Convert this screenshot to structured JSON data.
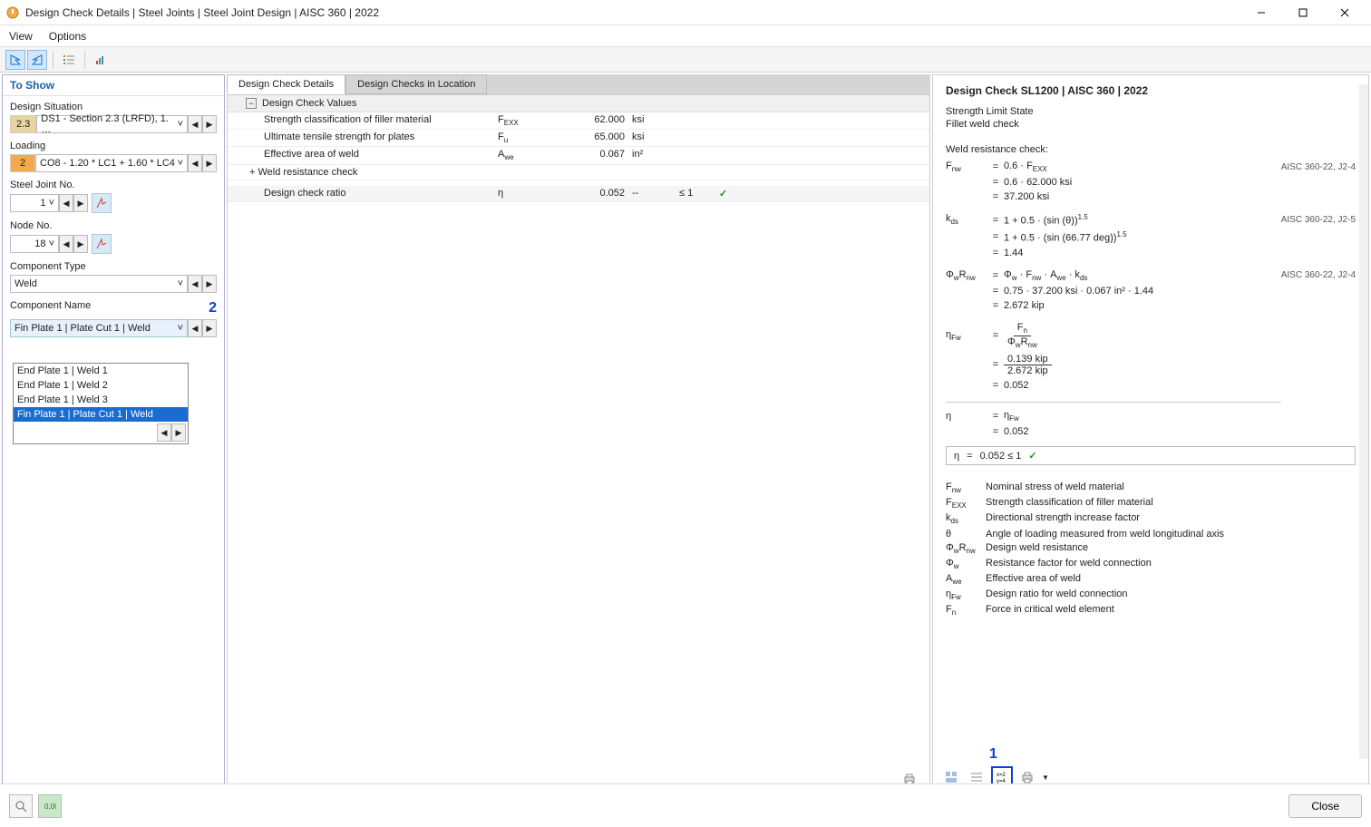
{
  "window": {
    "title": "Design Check Details | Steel Joints | Steel Joint Design | AISC 360 | 2022"
  },
  "menu": {
    "view": "View",
    "options": "Options"
  },
  "sidebar": {
    "header": "To Show",
    "design_situation_label": "Design Situation",
    "design_situation_badge": "2.3",
    "design_situation_value": "DS1 - Section 2.3 (LRFD), 1. …",
    "loading_label": "Loading",
    "loading_badge": "2",
    "loading_value": "CO8 - 1.20 * LC1 + 1.60 * LC4",
    "steel_joint_label": "Steel Joint No.",
    "steel_joint_value": "1",
    "node_label": "Node No.",
    "node_value": "18",
    "component_type_label": "Component Type",
    "component_type_value": "Weld",
    "component_name_label": "Component Name",
    "component_name_value": "Fin Plate 1 | Plate Cut 1 | Weld",
    "component_name_options": [
      "End Plate 1 | Weld 1",
      "End Plate 1 | Weld 2",
      "End Plate 1 | Weld 3",
      "Fin Plate 1 | Plate Cut 1 | Weld"
    ],
    "annotation2": "2"
  },
  "tabs": {
    "tab1": "Design Check Details",
    "tab2": "Design Checks in Location"
  },
  "grid": {
    "section_hdr": "Design Check Values",
    "rows": [
      {
        "name": "Strength classification of filler material",
        "sym": "F_EXX",
        "val": "62.000",
        "unit": "ksi"
      },
      {
        "name": "Ultimate tensile strength for plates",
        "sym": "F_u",
        "val": "65.000",
        "unit": "ksi"
      },
      {
        "name": "Effective area of weld",
        "sym": "A_we",
        "val": "0.067",
        "unit": "in²"
      }
    ],
    "sub_hdr": "Weld resistance check",
    "ratio_row": {
      "name": "Design check ratio",
      "sym": "η",
      "val": "0.052",
      "unit": "--",
      "lim": "≤ 1"
    }
  },
  "right": {
    "title": "Design Check SL1200 | AISC 360 | 2022",
    "sub1": "Strength Limit State",
    "sub2": "Fillet weld check",
    "sec_hdr": "Weld resistance check:",
    "eq1_ref": "AISC 360-22, J2-4",
    "eq1_l1": "0.6  ·  F_EXX",
    "eq1_l2": "0.6  ·  62.000 ksi",
    "eq1_l3": "37.200 ksi",
    "eq2_ref": "AISC 360-22, J2-5",
    "eq2_l1": "1  +  0.5  ·  (sin (θ))^1.5",
    "eq2_l2": "1  +  0.5  ·  (sin (66.77 deg))^1.5",
    "eq2_l3": "1.44",
    "eq3_ref": "AISC 360-22, J2-4",
    "eq3_l1": "Φ_w  ·  F_nw  ·  A_we  ·  k_ds",
    "eq3_l2": "0.75  ·  37.200 ksi  ·  0.067 in²  ·  1.44",
    "eq3_l3": "2.672 kip",
    "eq4_num": "F_n",
    "eq4_den": "Φ_w R_nw",
    "eq4_num2": "0.139 kip",
    "eq4_den2": "2.672 kip",
    "eq4_l3": "0.052",
    "eq5_l1": "η_Fw",
    "eq5_l2": "0.052",
    "result_eta": "η",
    "result_eq": "=",
    "result_val": "0.052  ≤ 1",
    "legend": [
      {
        "sym": "F_nw",
        "desc": "Nominal stress of weld material"
      },
      {
        "sym": "F_EXX",
        "desc": "Strength classification of filler material"
      },
      {
        "sym": "k_ds",
        "desc": "Directional strength increase factor"
      },
      {
        "sym": "θ",
        "desc": "Angle of loading measured from weld longitudinal axis"
      },
      {
        "sym": "Φ_wR_nw",
        "desc": "Design weld resistance"
      },
      {
        "sym": "Φ_w",
        "desc": "Resistance factor for weld connection"
      },
      {
        "sym": "A_we",
        "desc": "Effective area of weld"
      },
      {
        "sym": "η_Fw",
        "desc": "Design ratio for weld connection"
      },
      {
        "sym": "F_n",
        "desc": "Force in critical weld element"
      }
    ],
    "annotation1": "1"
  },
  "footer": {
    "close": "Close"
  }
}
